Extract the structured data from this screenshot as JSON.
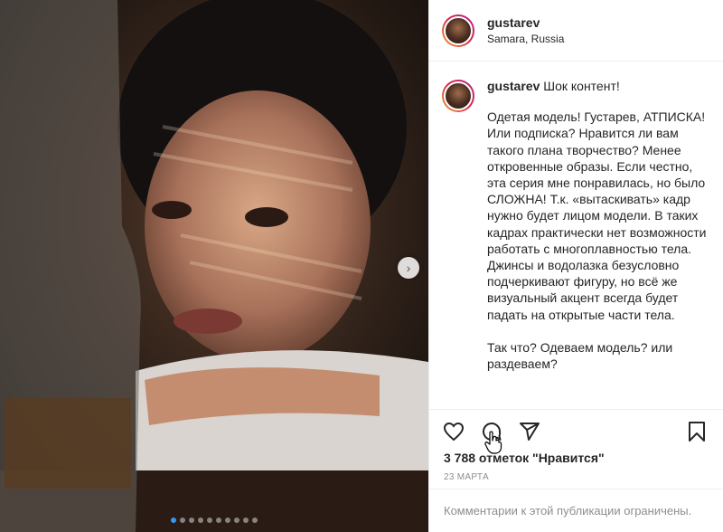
{
  "post": {
    "username": "gustarev",
    "location": "Samara, Russia",
    "caption_title": "Шок контент!",
    "caption_text": "Одетая модель! Густарев, АТПИСКА! Или подписка? Нравится ли вам такого плана творчество? Менее откровенные образы. Если честно, эта серия мне понравилась, но было СЛОЖНА! Т.к. «вытаскивать» кадр нужно будет лицом модели. В таких кадрах практически нет возможности работать с многоплавностью тела. Джинсы и водолазка безусловно подчеркивают фигуру, но всё же визуальный акцент всегда будет падать на открытые части тела.\n\nТак что? Одеваем модель? или раздеваем?",
    "likes": "3 788 отметок \"Нравится\"",
    "date": "23 марта",
    "comments_disabled": "Комментарии к этой публикации ограничены."
  },
  "carousel": {
    "total": 10,
    "active": 0
  },
  "icons": {
    "like": "heart-icon",
    "comment": "comment-icon",
    "share": "send-icon",
    "save": "bookmark-icon",
    "next": "chevron-right-icon"
  },
  "colors": {
    "accent": "#3897f0",
    "text": "#262626",
    "muted": "#8e8e8e"
  }
}
